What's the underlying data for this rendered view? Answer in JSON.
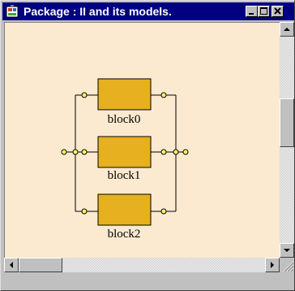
{
  "window": {
    "title": "Package : II and its models.",
    "icon": "package-app-icon"
  },
  "caption_buttons": [
    "minimize-icon",
    "maximize-icon",
    "close-icon"
  ],
  "diagram": {
    "blocks": [
      {
        "label": "block0"
      },
      {
        "label": "block1"
      },
      {
        "label": "block2"
      }
    ],
    "colors": {
      "canvas": "#fbead0",
      "block_fill": "#e6b020",
      "port_fill": "#ffff66",
      "wire": "#000000"
    }
  }
}
